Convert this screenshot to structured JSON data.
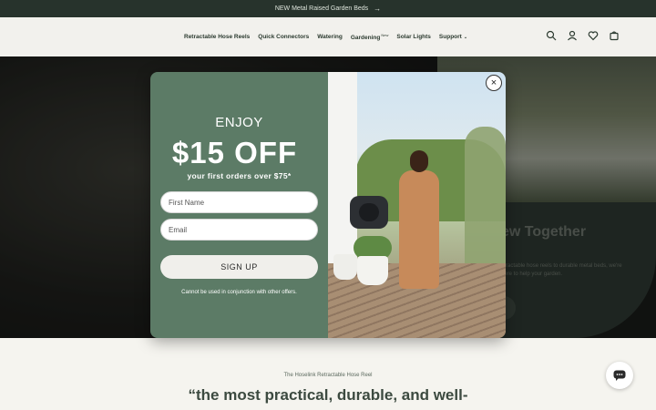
{
  "announcement": {
    "text": "NEW Metal Raised Garden Beds",
    "arrow": "→"
  },
  "nav": {
    "items": [
      {
        "label": "Retractable Hose Reels",
        "badge": ""
      },
      {
        "label": "Quick Connectors",
        "badge": ""
      },
      {
        "label": "Watering",
        "badge": ""
      },
      {
        "label": "Gardening",
        "badge": "New"
      },
      {
        "label": "Solar Lights",
        "badge": ""
      },
      {
        "label": "Support",
        "badge": ""
      }
    ],
    "icons": [
      "search-icon",
      "account-icon",
      "wishlist-heart-icon",
      "cart-icon"
    ]
  },
  "hero": {
    "title": "ew Together",
    "subtitle": "etractable hose reels to durable metal beds, we're here to help your garden."
  },
  "below_fold": {
    "eyebrow": "The Hoselink Retractable Hose Reel",
    "quote": "“the most practical, durable, and well-"
  },
  "popup": {
    "enjoy": "ENJOY",
    "offer": "$15 OFF",
    "subtitle": "your first orders over $75*",
    "first_name_placeholder": "First Name",
    "email_placeholder": "Email",
    "signup_label": "SIGN UP",
    "disclaimer": "Cannot be used in conjunction with other offers.",
    "close_symbol": "×"
  },
  "colors": {
    "announcement_bg": "#27332c",
    "popup_green": "#5c7b66",
    "header_bg": "#f2f1ed"
  }
}
